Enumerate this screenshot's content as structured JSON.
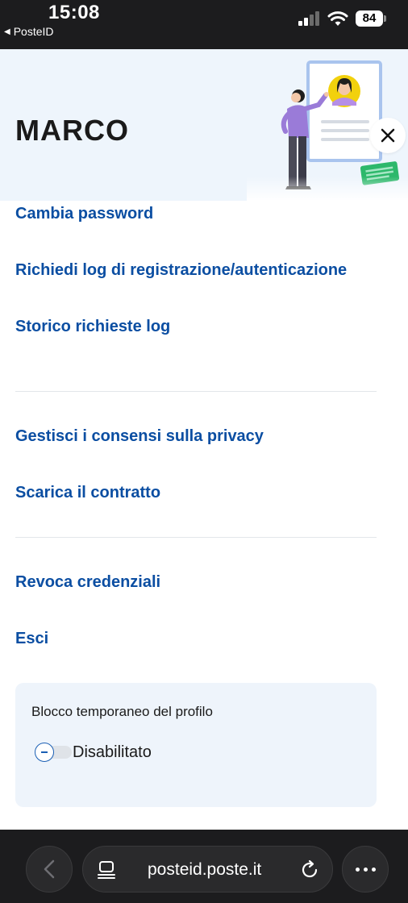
{
  "status_bar": {
    "time": "15:08",
    "back_app": "PosteID",
    "battery": "84"
  },
  "header": {
    "user_name": "MARCO",
    "close_icon": "close-icon",
    "illustration": "profile-card-illustration"
  },
  "menu": {
    "items": [
      {
        "label": "Cambia password"
      },
      {
        "label": "Richiedi log di registrazione/autenticazione"
      },
      {
        "label": "Storico richieste log"
      },
      {
        "label": "Gestisci i consensi sulla privacy"
      },
      {
        "label": "Scarica il contratto"
      },
      {
        "label": "Revoca credenziali"
      },
      {
        "label": "Esci"
      }
    ]
  },
  "profile_block": {
    "title": "Blocco temporaneo del profilo",
    "toggle_state": "Disabilitato",
    "enabled": false
  },
  "browser": {
    "url": "posteid.poste.it",
    "icons": [
      "back-arrow-icon",
      "tabs-icon",
      "reload-icon",
      "more-icon"
    ]
  },
  "colors": {
    "link": "#0b4ea2",
    "header_bg": "#eef5fc",
    "card_bg": "#eef4fb",
    "accent_yellow": "#f2d10d",
    "accent_green": "#2db86b",
    "illustration_purple": "#9a7bd8"
  }
}
